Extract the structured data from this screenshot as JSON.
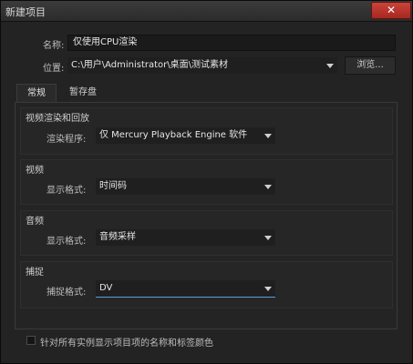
{
  "window": {
    "title": "新建项目",
    "close_glyph": "✕"
  },
  "name_row": {
    "label": "名称:",
    "value": "仅使用CPU渲染"
  },
  "location_row": {
    "label": "位置:",
    "value": "C:\\用户\\Administrator\\桌面\\测试素材",
    "browse_label": "浏览..."
  },
  "tabs": [
    {
      "label": "常规",
      "active": true
    },
    {
      "label": "暂存盘",
      "active": false
    }
  ],
  "sections": {
    "video_render": {
      "title": "视频渲染和回放",
      "label": "渲染程序:",
      "value": "仅 Mercury Playback Engine 软件"
    },
    "video": {
      "title": "视频",
      "label": "显示格式:",
      "value": "时间码"
    },
    "audio": {
      "title": "音频",
      "label": "显示格式:",
      "value": "音频采样"
    },
    "capture": {
      "title": "捕捉",
      "label": "捕捉格式:",
      "value": "DV"
    }
  },
  "checkbox": {
    "label": "针对所有实例显示项目项的名称和标签颜色",
    "checked": false
  },
  "colors": {
    "accent": "#5a9ddc",
    "close": "#c9443b"
  }
}
